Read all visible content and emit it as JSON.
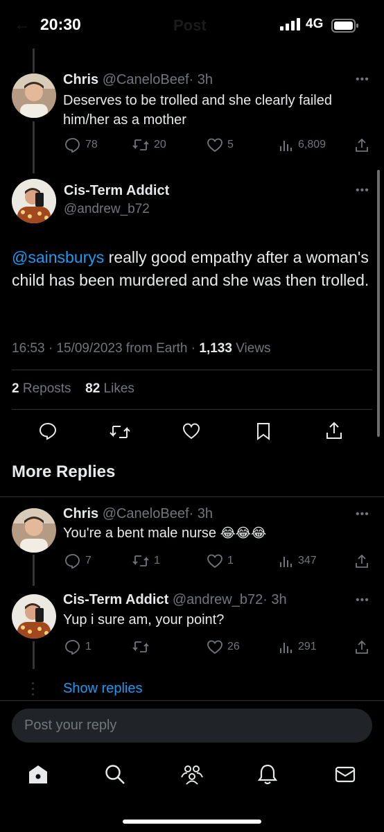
{
  "status_bar": {
    "time": "20:30",
    "network": "4G",
    "ghost_title": "Post"
  },
  "reply_top": {
    "name": "Chris",
    "handle": "@CaneloBeef",
    "time": "· 3h",
    "text": "Deserves to be trolled and she clearly failed him/her as a mother",
    "replies": "78",
    "reposts": "20",
    "likes": "5",
    "views": "6,809"
  },
  "main_post": {
    "name": "Cis-Term Addict",
    "handle": "@andrew_b72",
    "mention": "@sainsburys",
    "text": " really good empathy after a woman's child has been murdered and she was then trolled.",
    "meta_time": "16:53 · 15/09/2023 from Earth · ",
    "views_count": "1,133",
    "views_label": " Views",
    "reposts_count": "2",
    "reposts_label": " Reposts",
    "likes_count": "82",
    "likes_label": " Likes"
  },
  "more_replies": {
    "heading": "More Replies",
    "reply1": {
      "name": "Chris",
      "handle": "@CaneloBeef",
      "time": "· 3h",
      "text": "You're a bent male nurse ",
      "emoji": "😂😂😂",
      "replies": "7",
      "reposts": "1",
      "likes": "1",
      "views": "347"
    },
    "reply2": {
      "name": "Cis-Term Addict",
      "handle": "@andrew_b72",
      "time": "· 3h",
      "text": "Yup i sure am, your point?",
      "replies": "1",
      "reposts": "",
      "likes": "26",
      "views": "291"
    },
    "show_replies": "Show replies"
  },
  "composer": {
    "placeholder": "Post your reply"
  },
  "bottom_nav": {
    "icons": [
      "home-icon",
      "search-icon",
      "communities-icon",
      "notifications-icon",
      "messages-icon"
    ]
  },
  "colors": {
    "accent": "#1d9bf0",
    "muted": "#71767b",
    "background": "#000000"
  }
}
